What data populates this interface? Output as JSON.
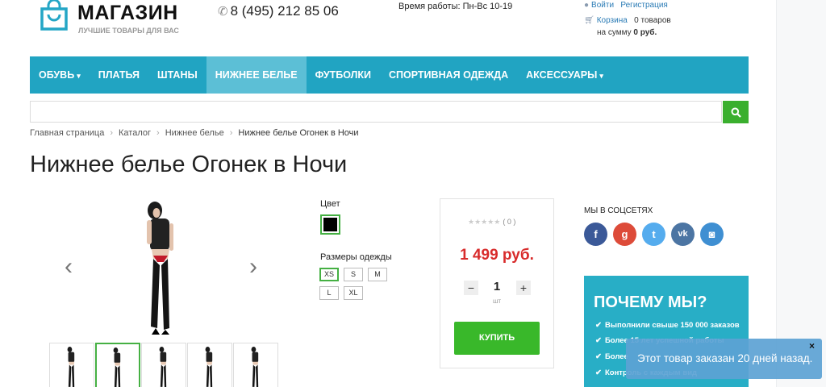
{
  "header": {
    "logo_name": "МАГАЗИН",
    "logo_tagline": "ЛУЧШИЕ ТОВАРЫ ДЛЯ ВАС",
    "phone": "8 (495) 212 85 06",
    "hours": "Время работы: Пн-Вс 10-19",
    "login": "Войти",
    "register": "Регистрация",
    "cart_label": "Корзина",
    "cart_count": "0 товаров",
    "cart_sum_label": "на сумму",
    "cart_sum": "0 руб.",
    "icons": {
      "logo": "shopping-bag-icon",
      "phone": "phone-icon",
      "user": "user-icon",
      "cart": "cart-icon"
    }
  },
  "nav": {
    "items": [
      {
        "label": "ОБУВЬ",
        "dropdown": "▾"
      },
      {
        "label": "ПЛАТЬЯ"
      },
      {
        "label": "ШТАНЫ"
      },
      {
        "label": "НИЖНЕЕ БЕЛЬЕ",
        "active": true
      },
      {
        "label": "ФУТБОЛКИ"
      },
      {
        "label": "СПОРТИВНАЯ ОДЕЖДА"
      },
      {
        "label": "АКСЕССУАРЫ",
        "dropdown": "▾"
      }
    ]
  },
  "search": {
    "placeholder": "",
    "icon": "search-icon"
  },
  "breadcrumb": [
    "Главная страница",
    "Каталог",
    "Нижнее белье",
    "Нижнее белье Огонек в Ночи"
  ],
  "product": {
    "title": "Нижнее белье Огонек в Ночи",
    "color_label": "Цвет",
    "selected_color": "#000000",
    "sizes_label": "Размеры одежды",
    "sizes": [
      "XS",
      "S",
      "M",
      "L",
      "XL"
    ],
    "selected_size": "XS",
    "rating_stars": "★★★★★",
    "rating_count": "( 0 )",
    "price": "1 499 руб.",
    "quantity": "1",
    "unit": "шт",
    "qty_minus": "−",
    "qty_plus": "+",
    "buy_label": "КУПИТЬ",
    "gallery_prev": "‹",
    "gallery_next": "›",
    "thumbnails_count": 5,
    "selected_thumbnail": 2
  },
  "social": {
    "title": "МЫ В СОЦСЕТЯХ",
    "networks": [
      {
        "name": "facebook-icon",
        "glyph": "f",
        "color": "#3b5998"
      },
      {
        "name": "google-plus-icon",
        "glyph": "g",
        "color": "#dd4b39"
      },
      {
        "name": "twitter-icon",
        "glyph": "t",
        "color": "#55acee"
      },
      {
        "name": "vk-icon",
        "glyph": "vk",
        "color": "#4c75a3"
      },
      {
        "name": "instagram-icon",
        "glyph": "◙",
        "color": "#3f8fd2"
      }
    ]
  },
  "why_us": {
    "title": "ПОЧЕМУ МЫ?",
    "items": [
      "Выполнили свыше 150 000 заказов",
      "Более 15 лет успешной работы",
      "Более",
      "Контроль с каждым вид"
    ]
  },
  "toast": {
    "text": "Этот товар заказан 20 дней назад.",
    "close": "×"
  },
  "colors": {
    "nav_bg": "#21a4c2",
    "nav_active": "#5cbfd6",
    "accent_green": "#39b82a",
    "price_red": "#d82b2b",
    "toast_bg": "#5ca2d4"
  }
}
